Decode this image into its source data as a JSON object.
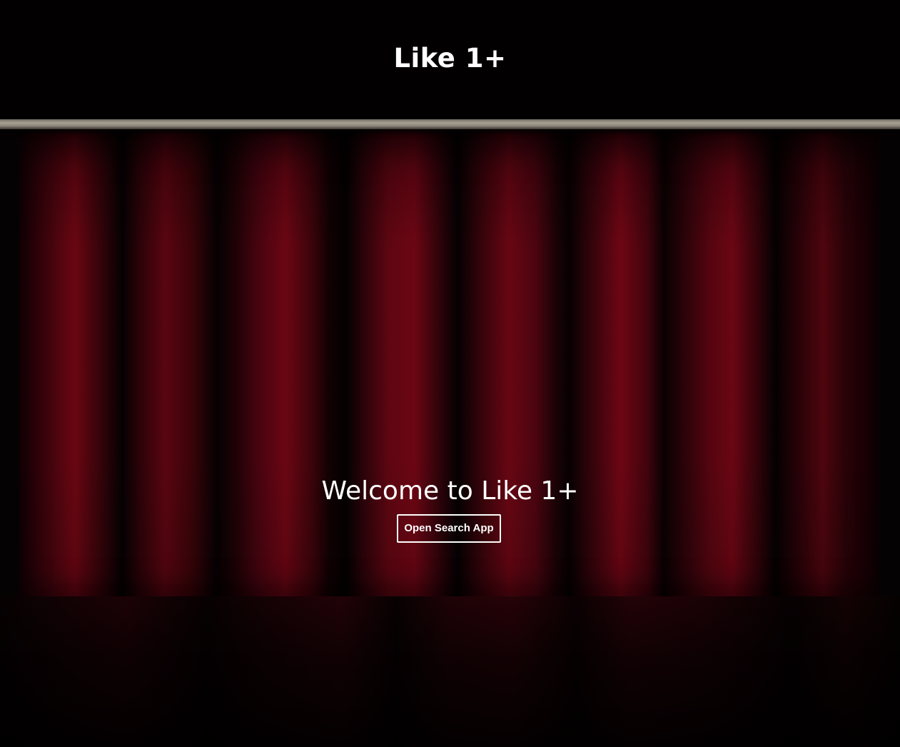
{
  "header": {
    "title": "Like 1+"
  },
  "hero": {
    "welcome_text": "Welcome to Like 1+",
    "open_button_label": "Open Search App"
  },
  "colors": {
    "background": "#030102",
    "curtain_red": "#6a0612",
    "rail": "#a7a194",
    "text": "#ffffff"
  }
}
